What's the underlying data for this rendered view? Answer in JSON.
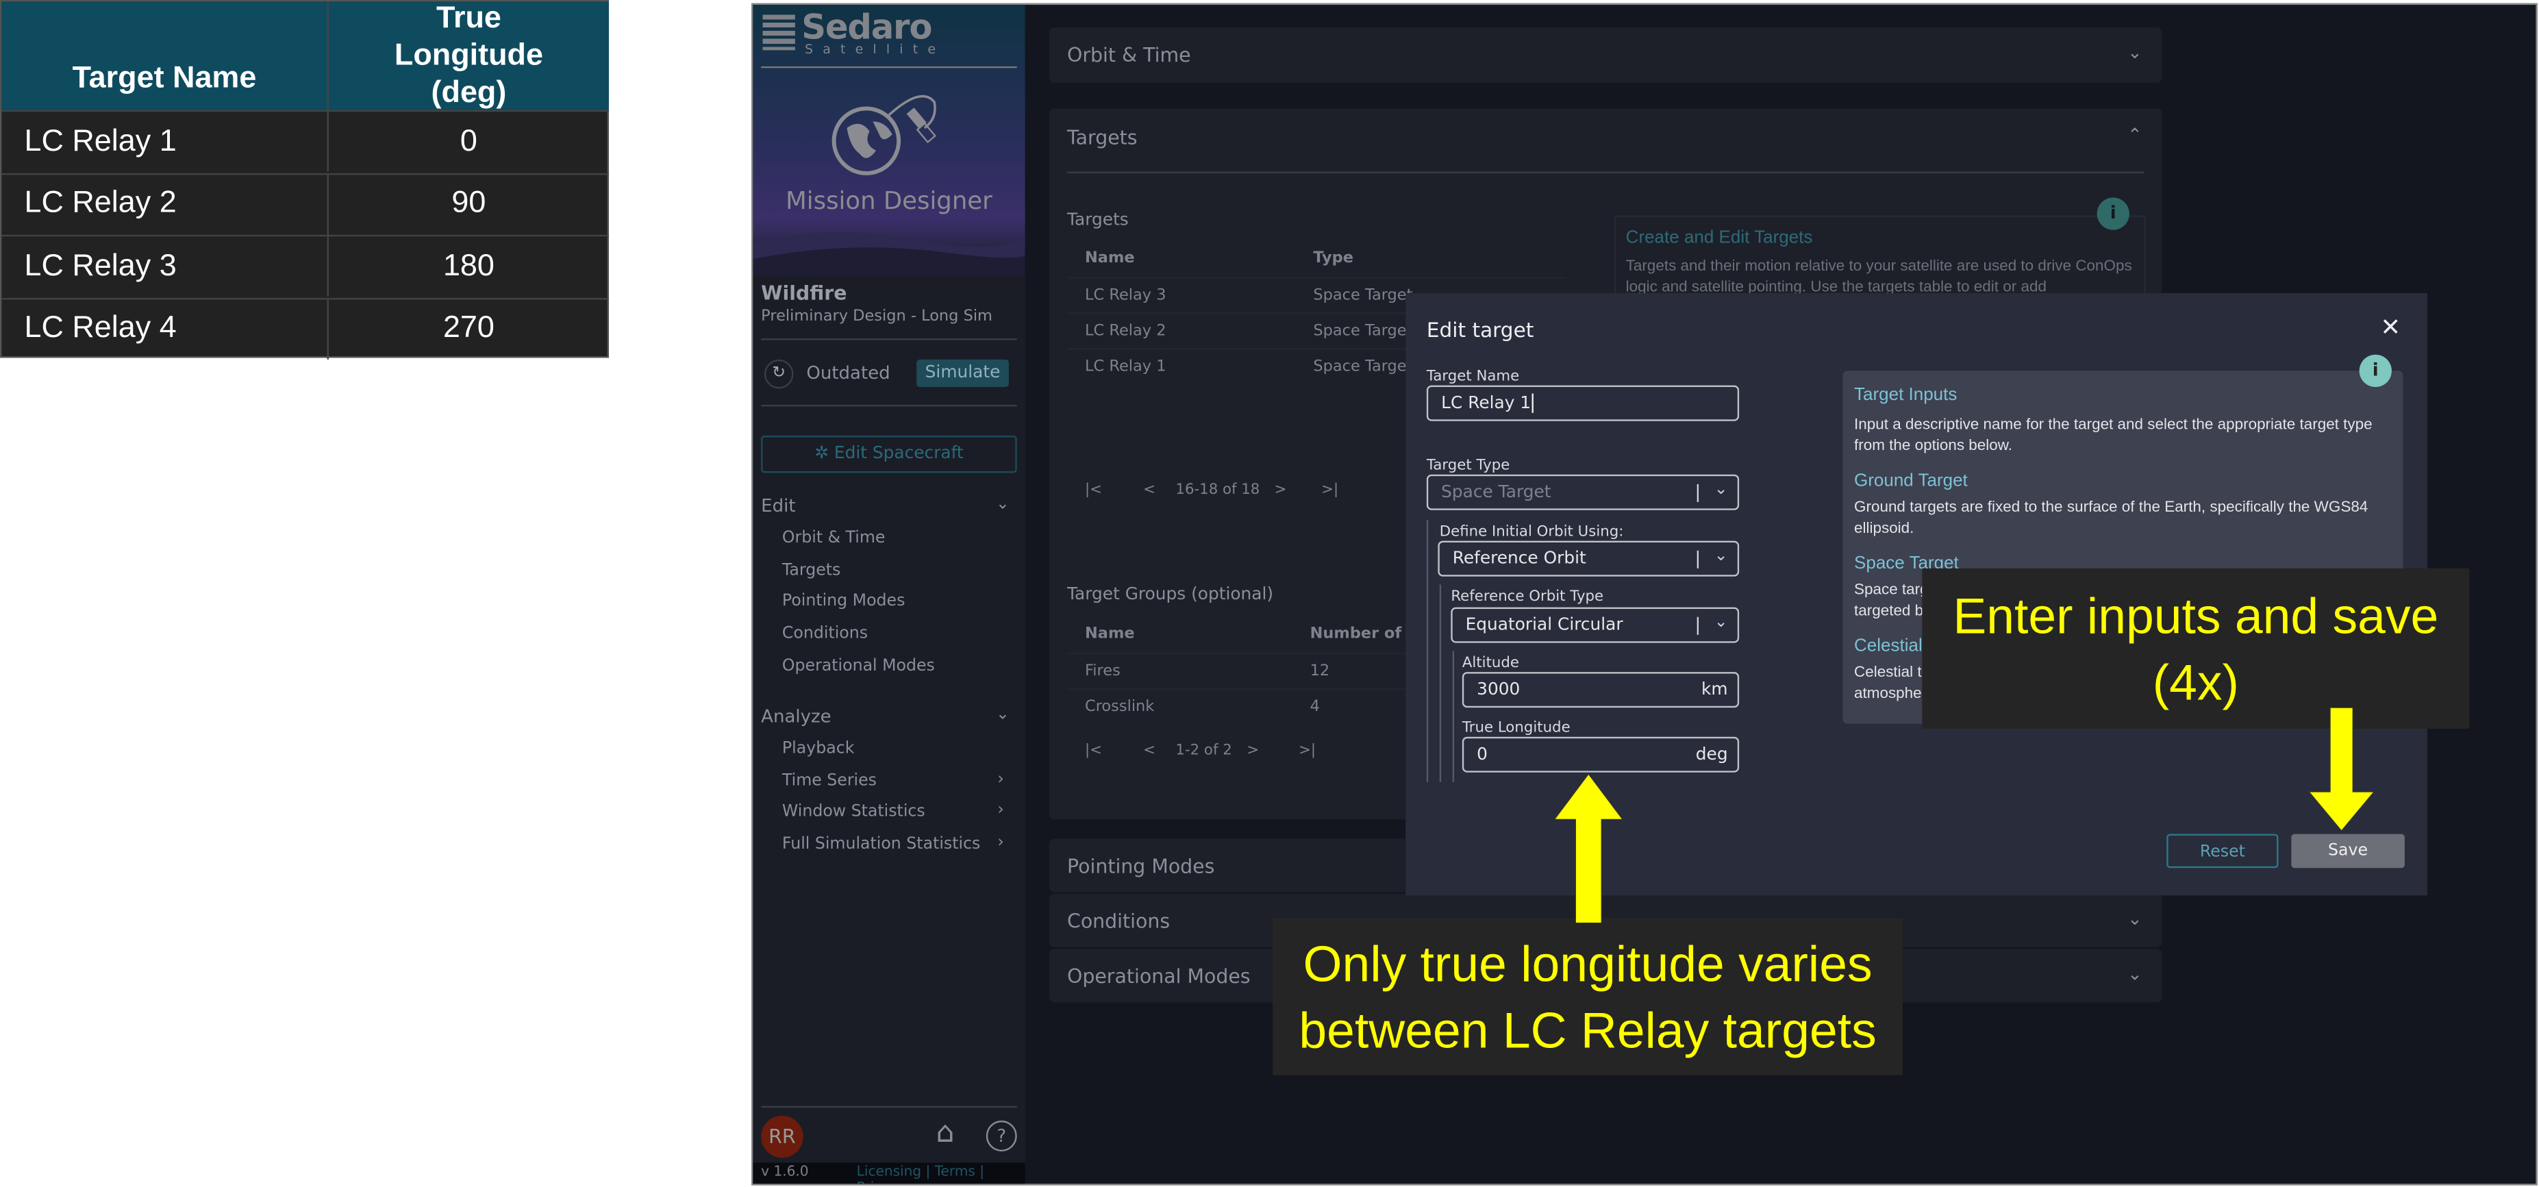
{
  "table": {
    "headers": [
      "Target Name",
      "True Longitude (deg)"
    ],
    "rows": [
      [
        "LC Relay 1",
        "0"
      ],
      [
        "LC Relay 2",
        "90"
      ],
      [
        "LC Relay 3",
        "180"
      ],
      [
        "LC Relay 4",
        "270"
      ]
    ],
    "header_color": "#0f4b5e"
  },
  "sidebar": {
    "logo": "Sedaro",
    "logo_sub": "Satellite",
    "app_title": "Mission Designer",
    "project": "Wildfire",
    "scenario": "Preliminary Design - Long Sim",
    "status": "Outdated",
    "simulate": "Simulate",
    "edit_spacecraft": "Edit Spacecraft",
    "edit_label": "Edit",
    "edit_items": [
      "Orbit & Time",
      "Targets",
      "Pointing Modes",
      "Conditions",
      "Operational Modes"
    ],
    "analyze_label": "Analyze",
    "analyze_items": [
      "Playback",
      "Time Series",
      "Window Statistics",
      "Full Simulation Statistics"
    ],
    "avatar": "RR",
    "version": "v 1.6.0",
    "links": "Licensing | Terms | Privacy"
  },
  "main": {
    "sections": [
      "Orbit & Time",
      "Targets",
      "Pointing Modes",
      "Conditions",
      "Operational Modes"
    ],
    "targets_label": "Targets",
    "targets_table": {
      "headers": [
        "Name",
        "Type"
      ],
      "rows": [
        [
          "LC Relay 3",
          "Space Target"
        ],
        [
          "LC Relay 2",
          "Space Target"
        ],
        [
          "LC Relay 1",
          "Space Target"
        ]
      ],
      "pagination": "16-18 of 18"
    },
    "groups_label": "Target Groups (optional)",
    "groups_table": {
      "headers": [
        "Name",
        "Number of Ta"
      ],
      "rows": [
        [
          "Fires",
          "12"
        ],
        [
          "Crosslink",
          "4"
        ]
      ],
      "pagination": "1-2 of 2"
    },
    "info_title": "Create and Edit Targets",
    "info_text": "Targets and their motion relative to your satellite are used to drive ConOps logic and satellite pointing. Use the targets table to edit or add"
  },
  "modal": {
    "title": "Edit target",
    "target_name_label": "Target Name",
    "target_name": "LC Relay 1",
    "target_type_label": "Target Type",
    "target_type": "Space Target",
    "define_label": "Define Initial Orbit Using:",
    "define_value": "Reference Orbit",
    "ref_type_label": "Reference Orbit Type",
    "ref_type": "Equatorial Circular",
    "altitude_label": "Altitude",
    "altitude": "3000",
    "altitude_unit": "km",
    "true_lon_label": "True Longitude",
    "true_lon": "0",
    "true_lon_unit": "deg",
    "reset": "Reset",
    "save": "Save",
    "help": {
      "h1": "Target Inputs",
      "p1": "Input a descriptive name for the target and select the appropriate target type from the options below.",
      "h2": "Ground Target",
      "p2": "Ground targets are fixed to the surface of the Earth, specifically the WGS84 ellipsoid.",
      "h3": "Space Target",
      "p3": "Space targ",
      "p3b": "targeted b",
      "h4": "Celestial T",
      "p4": "Celestial t",
      "p4b": "atmosphe"
    }
  },
  "callouts": {
    "save": "Enter inputs and save (4x)",
    "longitude": "Only true longitude varies between LC Relay targets"
  },
  "colors": {
    "accent": "#2a7a8c",
    "callout_text": "#ffff00",
    "danger": "#6b1c0c"
  }
}
